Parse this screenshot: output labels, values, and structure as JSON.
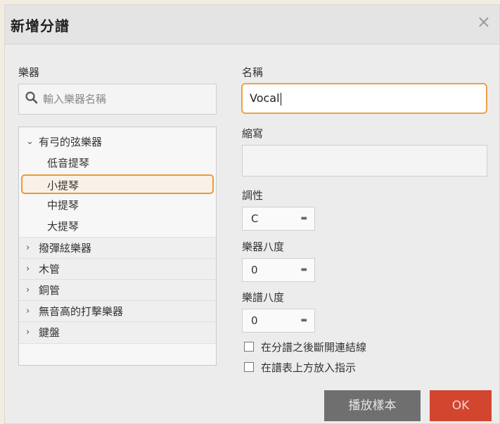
{
  "dialog": {
    "title": "新增分譜",
    "close_label": "×"
  },
  "instruments": {
    "label": "樂器",
    "search_placeholder": "輸入樂器名稱",
    "tree": {
      "expanded_group": {
        "label": "有弓的弦樂器",
        "children": [
          "低音提琴",
          "小提琴",
          "中提琴",
          "大提琴"
        ],
        "selected": "小提琴"
      },
      "collapsed_groups": [
        "撥彈絃樂器",
        "木管",
        "銅管",
        "無音高的打擊樂器",
        "鍵盤"
      ]
    }
  },
  "form": {
    "name_label": "名稱",
    "name_value": "Vocal",
    "abbr_label": "縮寫",
    "abbr_value": "",
    "key_label": "調性",
    "key_value": "C",
    "instrument_octave_label": "樂器八度",
    "instrument_octave_value": "0",
    "score_octave_label": "樂譜八度",
    "score_octave_value": "0",
    "checkbox_break_ties": "在分譜之後斷開連結線",
    "checkbox_show_above": "在譜表上方放入指示"
  },
  "buttons": {
    "play_sample": "播放樣本",
    "ok": "OK"
  },
  "colors": {
    "focus": "#f0a04a",
    "ok": "#d2452f",
    "play": "#6f6f6f"
  }
}
